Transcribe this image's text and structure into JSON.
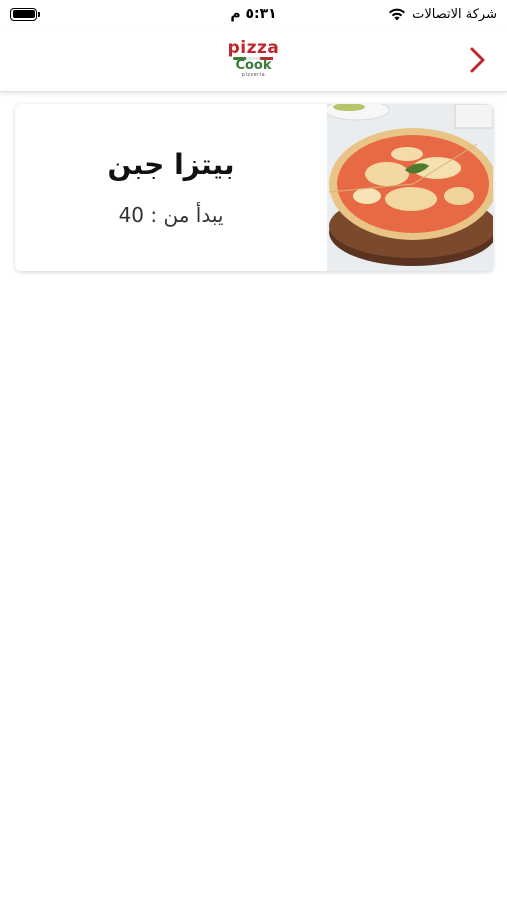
{
  "status_bar": {
    "carrier": "شركة الاتصالات",
    "time": "٥:٣١ م",
    "battery_level": 1.0
  },
  "header": {
    "logo": {
      "top": "pizza",
      "middle": "Cook",
      "sub": "pizzeria"
    },
    "back_icon": "chevron-right-icon",
    "accent_color": "#c0262d"
  },
  "products": [
    {
      "name": "بيتزا جبن",
      "price_label": "يبدأ من : 40",
      "image": "cheese-pizza-image"
    }
  ]
}
